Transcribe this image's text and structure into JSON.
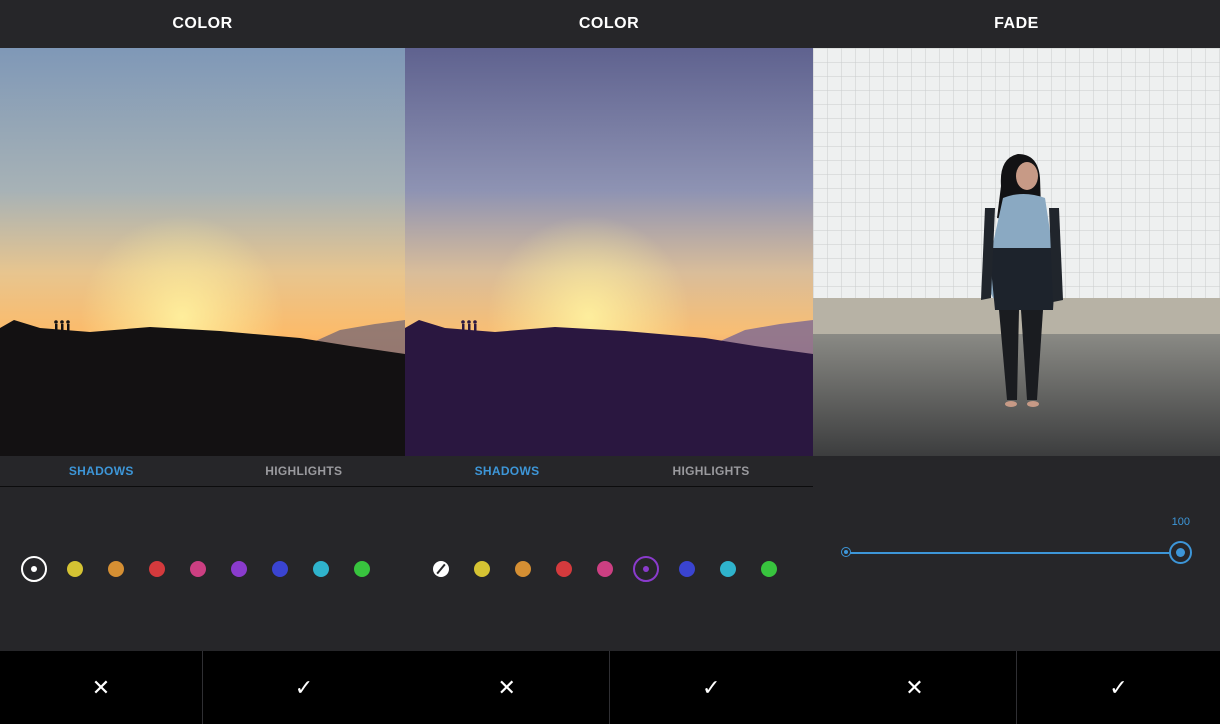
{
  "panel1": {
    "title": "COLOR",
    "tabs": [
      {
        "label": "SHADOWS",
        "active": true
      },
      {
        "label": "HIGHLIGHTS",
        "active": false
      }
    ],
    "swatches": [
      {
        "color": "#ffffff",
        "selected": true
      },
      {
        "color": "#d5c333"
      },
      {
        "color": "#d58f33"
      },
      {
        "color": "#d43a3d"
      },
      {
        "color": "#cc3f82"
      },
      {
        "color": "#8a3bcd"
      },
      {
        "color": "#3a44d1"
      },
      {
        "color": "#2fb3cc"
      },
      {
        "color": "#38c43e"
      }
    ],
    "cancel_icon": "✕",
    "confirm_icon": "✓"
  },
  "panel2": {
    "title": "COLOR",
    "tabs": [
      {
        "label": "SHADOWS",
        "active": true
      },
      {
        "label": "HIGHLIGHTS",
        "active": false
      }
    ],
    "swatches": [
      {
        "color": "#ffffff",
        "none": true
      },
      {
        "color": "#d5c333"
      },
      {
        "color": "#d58f33"
      },
      {
        "color": "#d43a3d"
      },
      {
        "color": "#cc3f82"
      },
      {
        "color": "#8a3bcd",
        "selected": true
      },
      {
        "color": "#3a44d1"
      },
      {
        "color": "#2fb3cc"
      },
      {
        "color": "#38c43e"
      }
    ],
    "cancel_icon": "✕",
    "confirm_icon": "✓"
  },
  "panel3": {
    "title": "FADE",
    "slider_value": "100",
    "slider_fraction": 1.0,
    "cancel_icon": "✕",
    "confirm_icon": "✓"
  },
  "colors": {
    "accent": "#3d96d8",
    "panel_bg": "#262629",
    "bottom_bar": "#000000"
  }
}
